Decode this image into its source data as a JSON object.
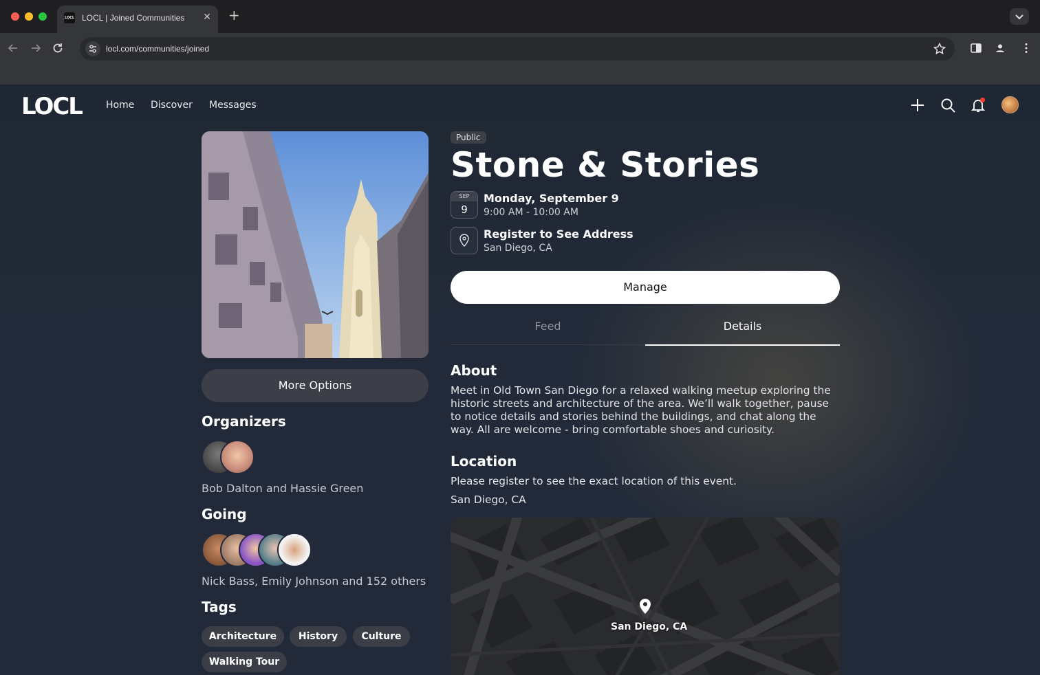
{
  "browser": {
    "tab_title": "LOCL | Joined Communities",
    "favicon_text": "LOCL",
    "url": "locl.com/communities/joined",
    "icons": [
      "back-icon",
      "forward-icon",
      "reload-icon",
      "tune-icon",
      "star-icon",
      "sidepanel-icon",
      "profile-icon",
      "kebab-icon",
      "close-icon",
      "plus-icon",
      "chevron-down-icon"
    ]
  },
  "header": {
    "logo": "LOCL",
    "nav": [
      "Home",
      "Discover",
      "Messages"
    ],
    "icons": [
      "plus-icon",
      "search-icon",
      "bell-icon",
      "avatar"
    ]
  },
  "event": {
    "visibility": "Public",
    "title": "Stone & Stories",
    "date": {
      "month": "SEP",
      "day": "9",
      "line1": "Monday, September 9",
      "line2": "9:00 AM - 10:00 AM"
    },
    "location": {
      "line1": "Register to See Address",
      "line2": "San Diego, CA"
    },
    "manage_label": "Manage",
    "more_options_label": "More Options",
    "tabs": [
      "Feed",
      "Details"
    ],
    "active_tab": "Details"
  },
  "left": {
    "organizers_heading": "Organizers",
    "organizers_names": "Bob Dalton and Hassie Green",
    "going_heading": "Going",
    "going_names": "Nick Bass, Emily Johnson and 152 others",
    "tags_heading": "Tags",
    "tags": [
      "Architecture",
      "History",
      "Culture",
      "Walking Tour"
    ]
  },
  "details": {
    "about_heading": "About",
    "about_text": "Meet in Old Town San Diego for a relaxed walking meetup exploring the historic streets and architecture of the area. We’ll walk together, pause to notice details and stories behind the buildings, and chat along the way. All are welcome - bring comfortable shoes and curiosity.",
    "location_heading": "Location",
    "location_note": "Please register to see the exact location of this event.",
    "location_city": "San Diego, CA",
    "map_label": "San Diego, CA"
  }
}
